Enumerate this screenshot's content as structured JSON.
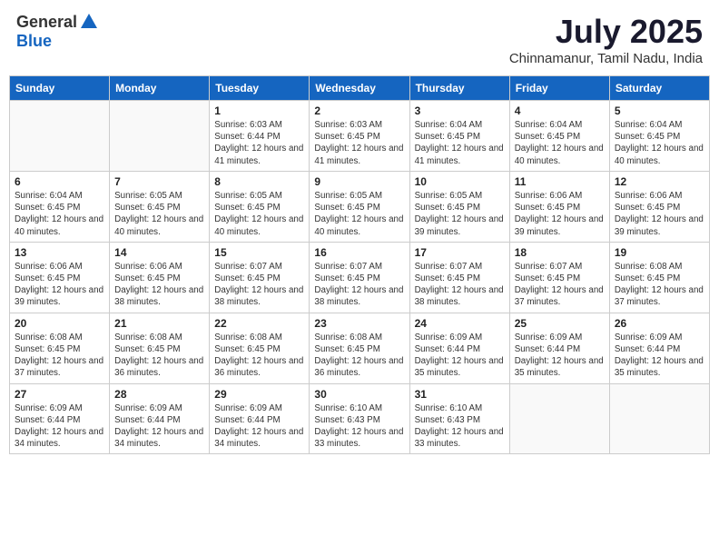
{
  "header": {
    "logo_general": "General",
    "logo_blue": "Blue",
    "month": "July 2025",
    "location": "Chinnamanur, Tamil Nadu, India"
  },
  "weekdays": [
    "Sunday",
    "Monday",
    "Tuesday",
    "Wednesday",
    "Thursday",
    "Friday",
    "Saturday"
  ],
  "weeks": [
    [
      {
        "day": "",
        "sunrise": "",
        "sunset": "",
        "daylight": ""
      },
      {
        "day": "",
        "sunrise": "",
        "sunset": "",
        "daylight": ""
      },
      {
        "day": "1",
        "sunrise": "Sunrise: 6:03 AM",
        "sunset": "Sunset: 6:44 PM",
        "daylight": "Daylight: 12 hours and 41 minutes."
      },
      {
        "day": "2",
        "sunrise": "Sunrise: 6:03 AM",
        "sunset": "Sunset: 6:45 PM",
        "daylight": "Daylight: 12 hours and 41 minutes."
      },
      {
        "day": "3",
        "sunrise": "Sunrise: 6:04 AM",
        "sunset": "Sunset: 6:45 PM",
        "daylight": "Daylight: 12 hours and 41 minutes."
      },
      {
        "day": "4",
        "sunrise": "Sunrise: 6:04 AM",
        "sunset": "Sunset: 6:45 PM",
        "daylight": "Daylight: 12 hours and 40 minutes."
      },
      {
        "day": "5",
        "sunrise": "Sunrise: 6:04 AM",
        "sunset": "Sunset: 6:45 PM",
        "daylight": "Daylight: 12 hours and 40 minutes."
      }
    ],
    [
      {
        "day": "6",
        "sunrise": "Sunrise: 6:04 AM",
        "sunset": "Sunset: 6:45 PM",
        "daylight": "Daylight: 12 hours and 40 minutes."
      },
      {
        "day": "7",
        "sunrise": "Sunrise: 6:05 AM",
        "sunset": "Sunset: 6:45 PM",
        "daylight": "Daylight: 12 hours and 40 minutes."
      },
      {
        "day": "8",
        "sunrise": "Sunrise: 6:05 AM",
        "sunset": "Sunset: 6:45 PM",
        "daylight": "Daylight: 12 hours and 40 minutes."
      },
      {
        "day": "9",
        "sunrise": "Sunrise: 6:05 AM",
        "sunset": "Sunset: 6:45 PM",
        "daylight": "Daylight: 12 hours and 40 minutes."
      },
      {
        "day": "10",
        "sunrise": "Sunrise: 6:05 AM",
        "sunset": "Sunset: 6:45 PM",
        "daylight": "Daylight: 12 hours and 39 minutes."
      },
      {
        "day": "11",
        "sunrise": "Sunrise: 6:06 AM",
        "sunset": "Sunset: 6:45 PM",
        "daylight": "Daylight: 12 hours and 39 minutes."
      },
      {
        "day": "12",
        "sunrise": "Sunrise: 6:06 AM",
        "sunset": "Sunset: 6:45 PM",
        "daylight": "Daylight: 12 hours and 39 minutes."
      }
    ],
    [
      {
        "day": "13",
        "sunrise": "Sunrise: 6:06 AM",
        "sunset": "Sunset: 6:45 PM",
        "daylight": "Daylight: 12 hours and 39 minutes."
      },
      {
        "day": "14",
        "sunrise": "Sunrise: 6:06 AM",
        "sunset": "Sunset: 6:45 PM",
        "daylight": "Daylight: 12 hours and 38 minutes."
      },
      {
        "day": "15",
        "sunrise": "Sunrise: 6:07 AM",
        "sunset": "Sunset: 6:45 PM",
        "daylight": "Daylight: 12 hours and 38 minutes."
      },
      {
        "day": "16",
        "sunrise": "Sunrise: 6:07 AM",
        "sunset": "Sunset: 6:45 PM",
        "daylight": "Daylight: 12 hours and 38 minutes."
      },
      {
        "day": "17",
        "sunrise": "Sunrise: 6:07 AM",
        "sunset": "Sunset: 6:45 PM",
        "daylight": "Daylight: 12 hours and 38 minutes."
      },
      {
        "day": "18",
        "sunrise": "Sunrise: 6:07 AM",
        "sunset": "Sunset: 6:45 PM",
        "daylight": "Daylight: 12 hours and 37 minutes."
      },
      {
        "day": "19",
        "sunrise": "Sunrise: 6:08 AM",
        "sunset": "Sunset: 6:45 PM",
        "daylight": "Daylight: 12 hours and 37 minutes."
      }
    ],
    [
      {
        "day": "20",
        "sunrise": "Sunrise: 6:08 AM",
        "sunset": "Sunset: 6:45 PM",
        "daylight": "Daylight: 12 hours and 37 minutes."
      },
      {
        "day": "21",
        "sunrise": "Sunrise: 6:08 AM",
        "sunset": "Sunset: 6:45 PM",
        "daylight": "Daylight: 12 hours and 36 minutes."
      },
      {
        "day": "22",
        "sunrise": "Sunrise: 6:08 AM",
        "sunset": "Sunset: 6:45 PM",
        "daylight": "Daylight: 12 hours and 36 minutes."
      },
      {
        "day": "23",
        "sunrise": "Sunrise: 6:08 AM",
        "sunset": "Sunset: 6:45 PM",
        "daylight": "Daylight: 12 hours and 36 minutes."
      },
      {
        "day": "24",
        "sunrise": "Sunrise: 6:09 AM",
        "sunset": "Sunset: 6:44 PM",
        "daylight": "Daylight: 12 hours and 35 minutes."
      },
      {
        "day": "25",
        "sunrise": "Sunrise: 6:09 AM",
        "sunset": "Sunset: 6:44 PM",
        "daylight": "Daylight: 12 hours and 35 minutes."
      },
      {
        "day": "26",
        "sunrise": "Sunrise: 6:09 AM",
        "sunset": "Sunset: 6:44 PM",
        "daylight": "Daylight: 12 hours and 35 minutes."
      }
    ],
    [
      {
        "day": "27",
        "sunrise": "Sunrise: 6:09 AM",
        "sunset": "Sunset: 6:44 PM",
        "daylight": "Daylight: 12 hours and 34 minutes."
      },
      {
        "day": "28",
        "sunrise": "Sunrise: 6:09 AM",
        "sunset": "Sunset: 6:44 PM",
        "daylight": "Daylight: 12 hours and 34 minutes."
      },
      {
        "day": "29",
        "sunrise": "Sunrise: 6:09 AM",
        "sunset": "Sunset: 6:44 PM",
        "daylight": "Daylight: 12 hours and 34 minutes."
      },
      {
        "day": "30",
        "sunrise": "Sunrise: 6:10 AM",
        "sunset": "Sunset: 6:43 PM",
        "daylight": "Daylight: 12 hours and 33 minutes."
      },
      {
        "day": "31",
        "sunrise": "Sunrise: 6:10 AM",
        "sunset": "Sunset: 6:43 PM",
        "daylight": "Daylight: 12 hours and 33 minutes."
      },
      {
        "day": "",
        "sunrise": "",
        "sunset": "",
        "daylight": ""
      },
      {
        "day": "",
        "sunrise": "",
        "sunset": "",
        "daylight": ""
      }
    ]
  ]
}
